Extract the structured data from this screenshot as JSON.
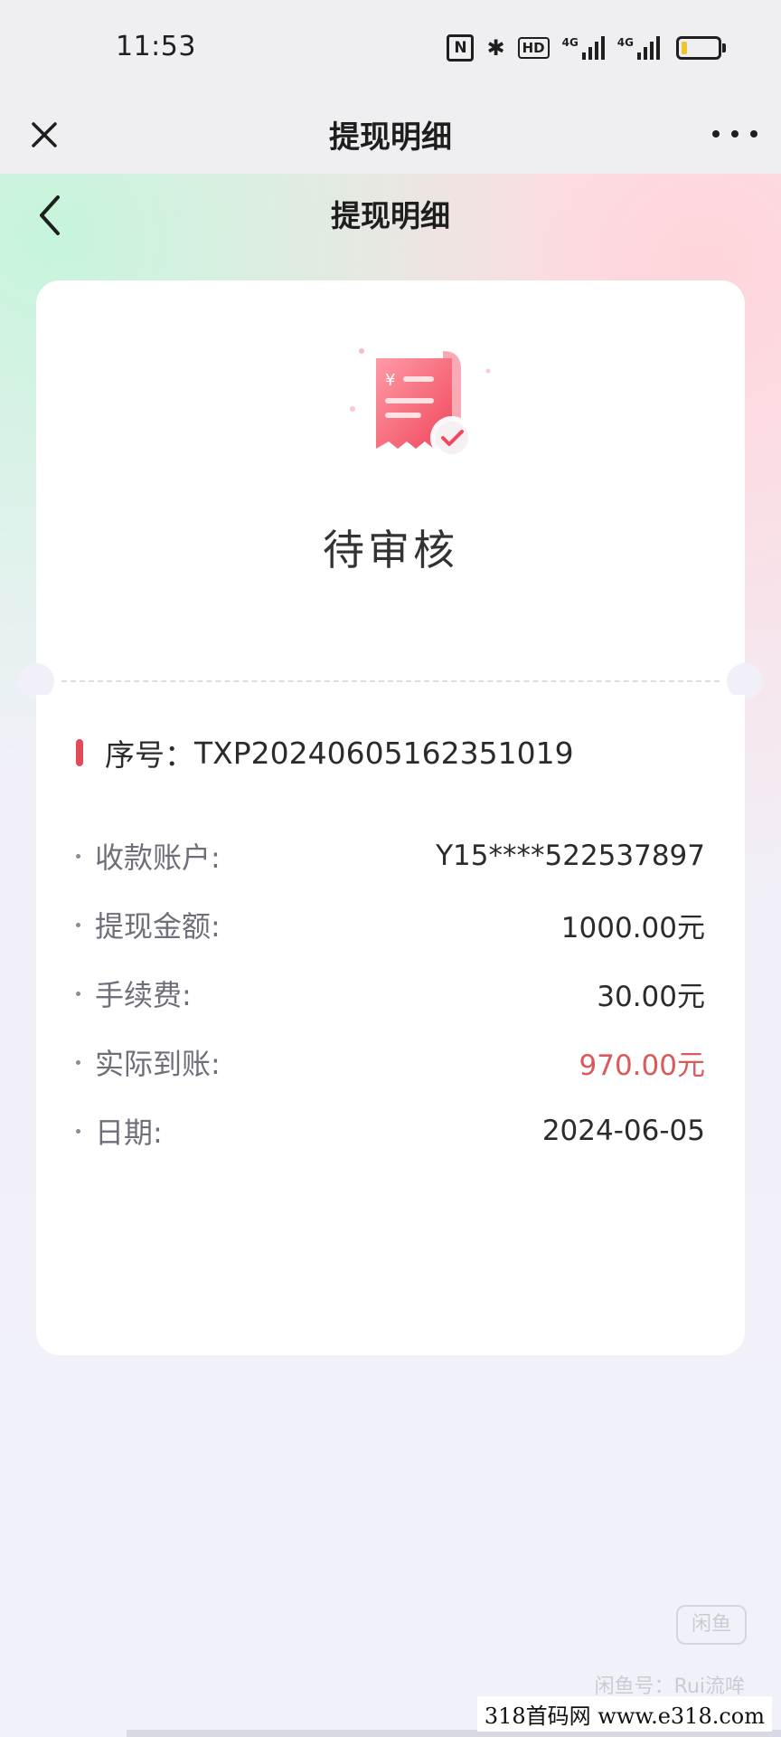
{
  "status_bar": {
    "time": "11:53",
    "nfc_label": "N",
    "bluetooth_label": "✱",
    "hd_label": "HD",
    "signal1_label": "4G",
    "signal2_label": "4G",
    "battery_level": 0.15
  },
  "app_nav": {
    "title": "提现明细",
    "close_icon": "close-icon",
    "more_icon": "more-icon"
  },
  "page": {
    "title": "提现明细",
    "back_icon": "back-chevron-icon"
  },
  "status_card": {
    "icon": "receipt-check-icon",
    "currency_symbol": "¥",
    "status": "待审核"
  },
  "details": {
    "serial_label": "序号：",
    "serial_value": "TXP20240605162351019",
    "rows": [
      {
        "label": "收款账户:",
        "value": "Y15****522537897",
        "highlight": false
      },
      {
        "label": "提现金额:",
        "value": "1000.00元",
        "highlight": false
      },
      {
        "label": "手续费:",
        "value": "30.00元",
        "highlight": false
      },
      {
        "label": "实际到账:",
        "value": "970.00元",
        "highlight": true
      },
      {
        "label": "日期:",
        "value": "2024-06-05",
        "highlight": false
      }
    ]
  },
  "colors": {
    "accent_red": "#e24a5a",
    "highlight_amount": "#d85a5a"
  },
  "watermarks": {
    "badge": "闲鱼",
    "handle": "闲鱼号：Rui流哞",
    "footer": "318首码网  www.e318.com"
  }
}
